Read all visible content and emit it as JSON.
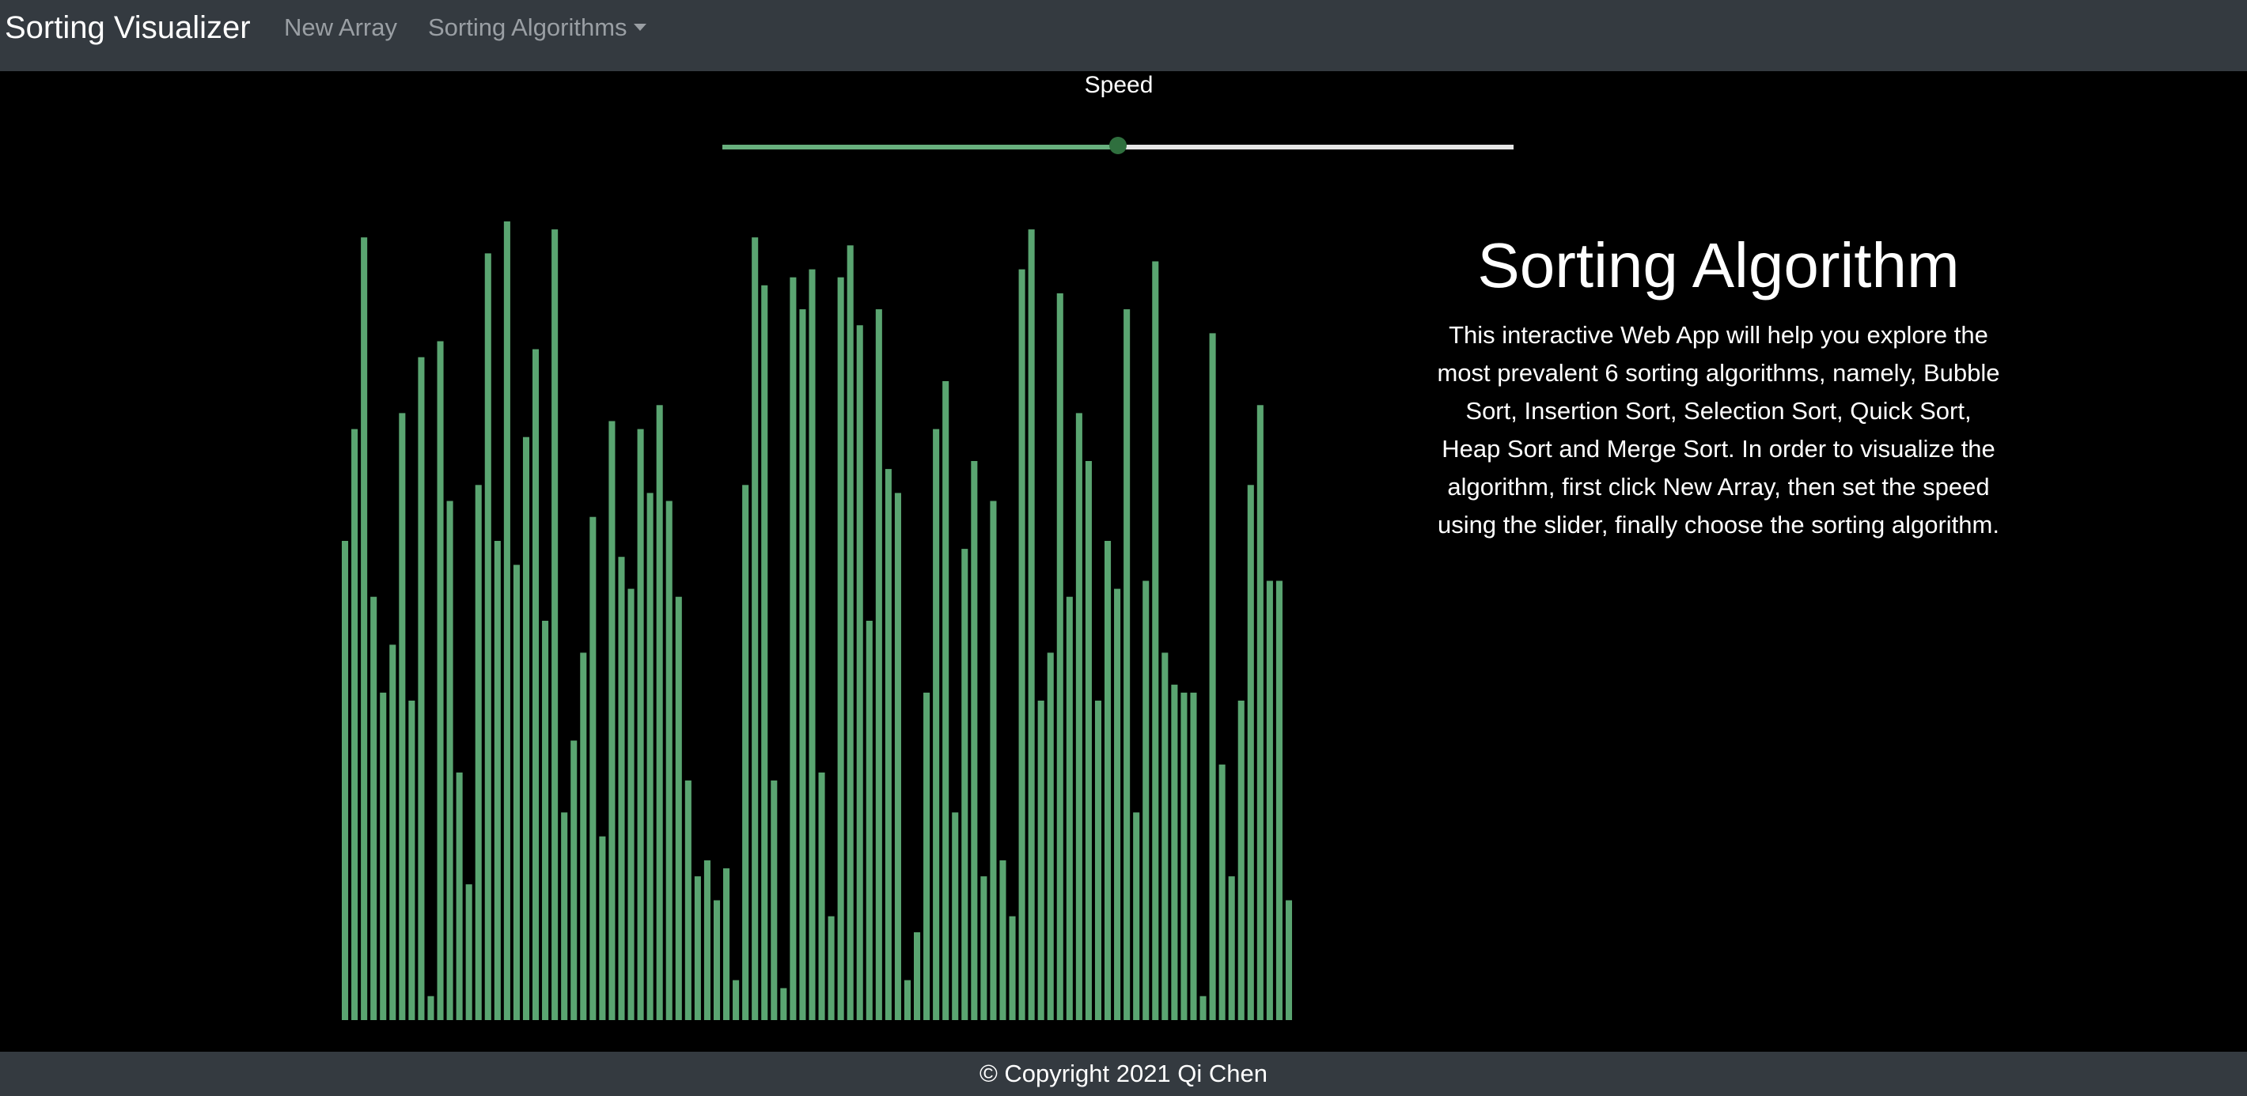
{
  "navbar": {
    "brand": "Sorting Visualizer",
    "new_array": "New Array",
    "sorting_algorithms": "Sorting Algorithms"
  },
  "speed": {
    "label": "Speed",
    "value_fraction": 0.5
  },
  "info": {
    "title": "Sorting Algorithm",
    "description": "This interactive Web App will help you explore the most prevalent 6 sorting algorithms, namely, Bubble Sort, Insertion Sort, Selection Sort, Quick Sort, Heap Sort and Merge Sort. In order to visualize the algorithm, first click New Array, then set the speed using the slider, finally choose the sorting algorithm."
  },
  "footer": {
    "text": "© Copyright 2021 Qi Chen"
  },
  "colors": {
    "bar": "#5aa571",
    "background": "#000000",
    "navbar": "#343a40"
  },
  "chart_data": {
    "type": "bar",
    "values": [
      60,
      74,
      98,
      53,
      41,
      47,
      76,
      40,
      83,
      3,
      85,
      65,
      31,
      17,
      67,
      96,
      60,
      100,
      57,
      73,
      84,
      50,
      99,
      26,
      35,
      46,
      63,
      23,
      75,
      58,
      54,
      74,
      66,
      77,
      65,
      53,
      30,
      18,
      20,
      15,
      19,
      5,
      67,
      98,
      92,
      30,
      4,
      93,
      89,
      94,
      31,
      13,
      93,
      97,
      87,
      50,
      89,
      69,
      66,
      5,
      11,
      41,
      74,
      80,
      26,
      59,
      70,
      18,
      65,
      20,
      13,
      94,
      99,
      40,
      46,
      91,
      53,
      76,
      70,
      40,
      60,
      54,
      89,
      26,
      55,
      95,
      46,
      42,
      41,
      41,
      3,
      86,
      32,
      18,
      40,
      67,
      77,
      55,
      55,
      15
    ]
  }
}
